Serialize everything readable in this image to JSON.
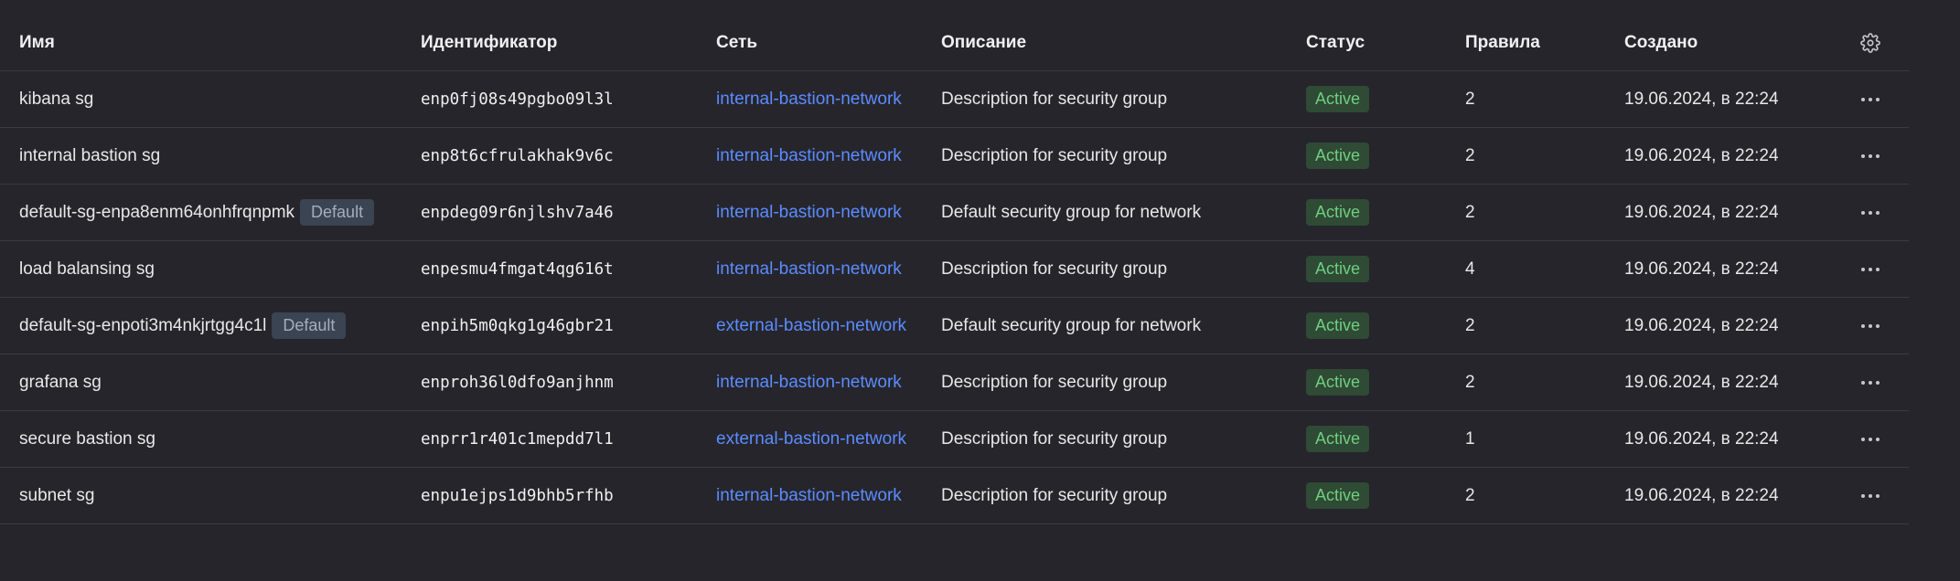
{
  "table": {
    "headers": {
      "name": "Имя",
      "id": "Идентификатор",
      "network": "Сеть",
      "description": "Описание",
      "status": "Статус",
      "rules": "Правила",
      "created": "Создано"
    },
    "settings_icon": "gear-icon",
    "rows": [
      {
        "name": "kibana sg",
        "badge": "",
        "id": "enp0fj08s49pgbo09l3l",
        "network": "internal-bastion-network",
        "description": "Description for security group",
        "status": "Active",
        "rules": "2",
        "created": "19.06.2024, в 22:24"
      },
      {
        "name": "internal bastion sg",
        "badge": "",
        "id": "enp8t6cfrulakhak9v6c",
        "network": "internal-bastion-network",
        "description": "Description for security group",
        "status": "Active",
        "rules": "2",
        "created": "19.06.2024, в 22:24"
      },
      {
        "name": "default-sg-enpa8enm64onhfrqnpmk",
        "badge": "Default",
        "id": "enpdeg09r6njlshv7a46",
        "network": "internal-bastion-network",
        "description": "Default security group for network",
        "status": "Active",
        "rules": "2",
        "created": "19.06.2024, в 22:24"
      },
      {
        "name": "load balansing sg",
        "badge": "",
        "id": "enpesmu4fmgat4qg616t",
        "network": "internal-bastion-network",
        "description": "Description for security group",
        "status": "Active",
        "rules": "4",
        "created": "19.06.2024, в 22:24"
      },
      {
        "name": "default-sg-enpoti3m4nkjrtgg4c1l",
        "badge": "Default",
        "id": "enpih5m0qkg1g46gbr21",
        "network": "external-bastion-network",
        "description": "Default security group for network",
        "status": "Active",
        "rules": "2",
        "created": "19.06.2024, в 22:24"
      },
      {
        "name": "grafana sg",
        "badge": "",
        "id": "enproh36l0dfo9anjhnm",
        "network": "internal-bastion-network",
        "description": "Description for security group",
        "status": "Active",
        "rules": "2",
        "created": "19.06.2024, в 22:24"
      },
      {
        "name": "secure bastion sg",
        "badge": "",
        "id": "enprr1r401c1mepdd7l1",
        "network": "external-bastion-network",
        "description": "Description for security group",
        "status": "Active",
        "rules": "1",
        "created": "19.06.2024, в 22:24"
      },
      {
        "name": "subnet sg",
        "badge": "",
        "id": "enpu1ejps1d9bhb5rfhb",
        "network": "internal-bastion-network",
        "description": "Description for security group",
        "status": "Active",
        "rules": "2",
        "created": "19.06.2024, в 22:24"
      }
    ],
    "row_action_icon": "more-horizontal-icon"
  },
  "colors": {
    "background": "#26252b",
    "link": "#5b8cff",
    "status_active_bg": "#2f4a35",
    "status_active_text": "#6fcf7f",
    "default_badge_bg": "#3a4452"
  }
}
